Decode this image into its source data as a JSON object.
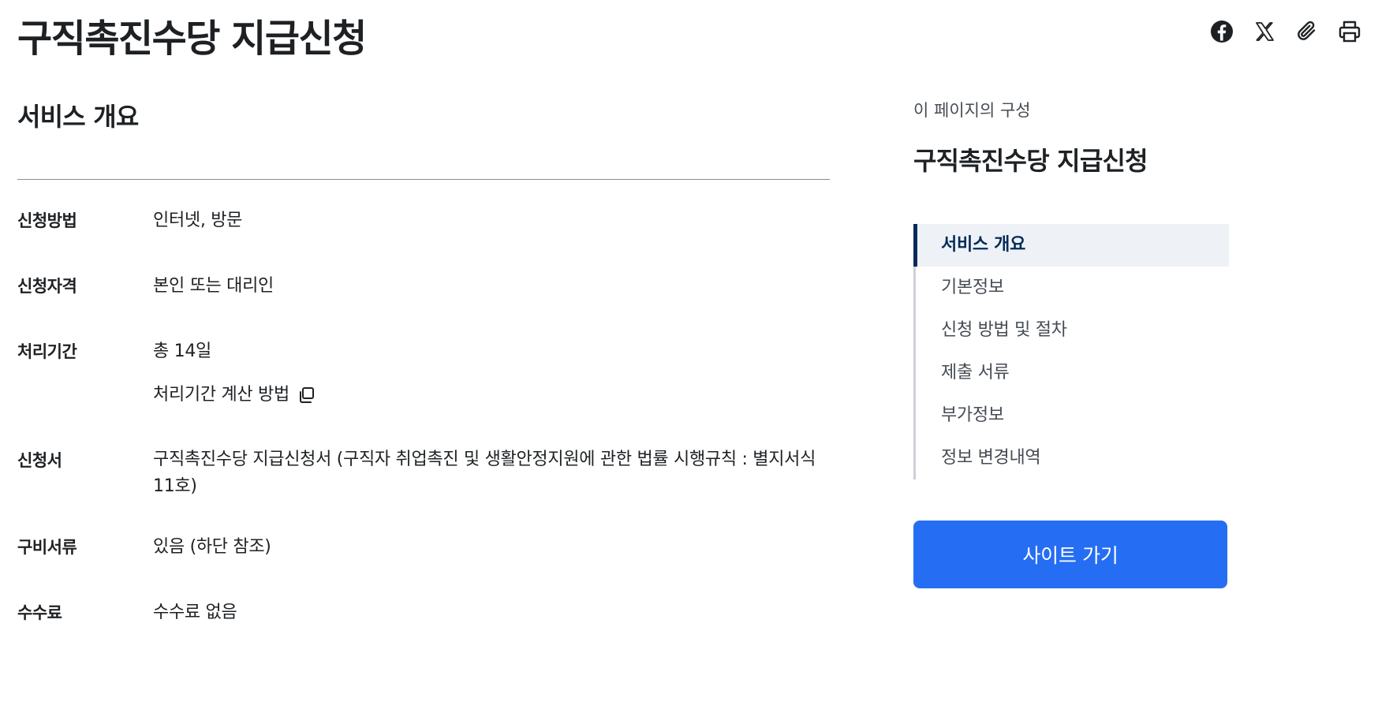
{
  "page": {
    "title": "구직촉진수당 지급신청"
  },
  "share": {
    "icons": [
      "facebook-icon",
      "x-icon",
      "paperclip-icon",
      "printer-icon"
    ]
  },
  "overview": {
    "heading": "서비스 개요",
    "rows": [
      {
        "label": "신청방법",
        "value": "인터넷, 방문"
      },
      {
        "label": "신청자격",
        "value": "본인 또는 대리인"
      },
      {
        "label": "처리기간",
        "value": "총 14일",
        "link": "처리기간 계산 방법"
      },
      {
        "label": "신청서",
        "value": "구직촉진수당 지급신청서 (구직자 취업촉진 및 생활안정지원에 관한 법률 시행규칙 : 별지서식 11호)"
      },
      {
        "label": "구비서류",
        "value": "있음 (하단 참조)"
      },
      {
        "label": "수수료",
        "value": "수수료 없음"
      }
    ]
  },
  "aside": {
    "caption": "이 페이지의 구성",
    "title": "구직촉진수당 지급신청",
    "toc": [
      {
        "label": "서비스 개요",
        "active": true
      },
      {
        "label": "기본정보",
        "active": false
      },
      {
        "label": "신청 방법 및 절차",
        "active": false
      },
      {
        "label": "제출 서류",
        "active": false
      },
      {
        "label": "부가정보",
        "active": false
      },
      {
        "label": "정보 변경내역",
        "active": false
      }
    ],
    "button_label": "사이트 가기"
  },
  "colors": {
    "primary_button": "#256ef4",
    "toc_active_text": "#052b57",
    "toc_active_bg": "#eef2f7",
    "text": "#1e2124"
  }
}
